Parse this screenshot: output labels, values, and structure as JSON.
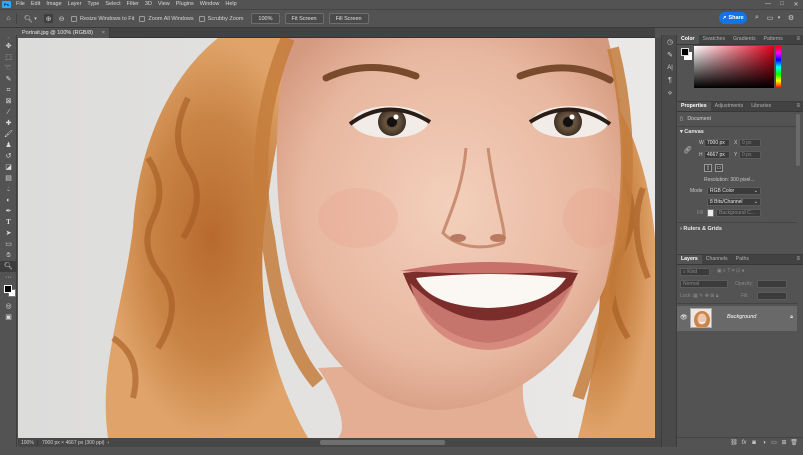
{
  "app": {
    "logo": "Ps"
  },
  "menu": [
    "File",
    "Edit",
    "Image",
    "Layer",
    "Type",
    "Select",
    "Filter",
    "3D",
    "View",
    "Plugins",
    "Window",
    "Help"
  ],
  "window_controls": [
    "—",
    "□",
    "✕"
  ],
  "options_bar": {
    "resize_windows": "Resize Windows to Fit",
    "zoom_all": "Zoom All Windows",
    "scrubby_zoom": "Scrubby Zoom",
    "zoom_value": "100%",
    "fit_screen": "Fit Screen",
    "fill_screen": "Fill Screen",
    "share": "Share"
  },
  "document": {
    "tab_title": "Portrait.jpg @ 100% (RGB/8)",
    "tab_close": "×"
  },
  "status": {
    "zoom": "100%",
    "info": "7000 px × 4667 px (300 ppi)"
  },
  "color_panel": {
    "tabs": [
      "Color",
      "Swatches",
      "Gradients",
      "Patterns"
    ],
    "active": "Color"
  },
  "properties_panel": {
    "tabs": [
      "Properties",
      "Adjustments",
      "Libraries"
    ],
    "doc_label": "Document",
    "canvas_title": "Canvas",
    "w_label": "W",
    "w_value": "7000 px",
    "h_label": "H",
    "h_value": "4667 px",
    "x_label": "X",
    "x_value": "0 px",
    "y_label": "Y",
    "y_value": "0 px",
    "resolution": "Resolution: 300 pixel...",
    "mode_label": "Mode",
    "mode_value": "RGB Color",
    "depth_value": "8 Bits/Channel",
    "fill_label": "Fill",
    "fill_value": "Background C...",
    "rulers_title": "Rulers & Grids"
  },
  "layers_panel": {
    "tabs": [
      "Layers",
      "Channels",
      "Paths"
    ],
    "kind_label": "Kind",
    "blend_mode": "Normal",
    "opacity_label": "Opacity:",
    "lock_label": "Lock:",
    "fill_label": "Fill:",
    "layer_name": "Background"
  },
  "colors": {
    "accent": "#1473e6",
    "ui_bg": "#535353",
    "panel_dark": "#424242"
  }
}
